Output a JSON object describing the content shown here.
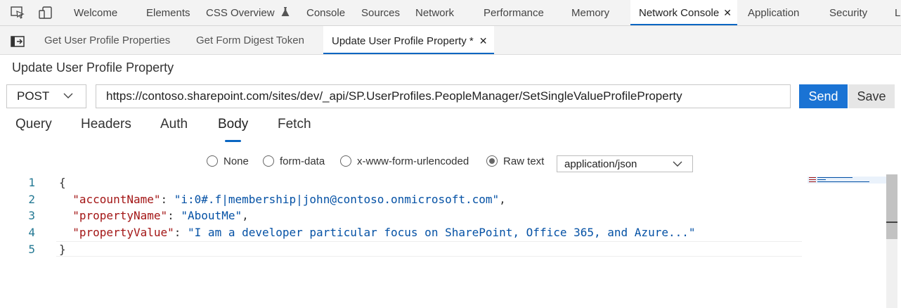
{
  "devtools": {
    "tabs": [
      {
        "label": "Welcome"
      },
      {
        "label": "Elements"
      },
      {
        "label": "CSS Overview"
      },
      {
        "label": "Console"
      },
      {
        "label": "Sources"
      },
      {
        "label": "Network"
      },
      {
        "label": "Performance"
      },
      {
        "label": "Memory"
      },
      {
        "label": "Network Console",
        "active": true
      },
      {
        "label": "Application"
      },
      {
        "label": "Security"
      },
      {
        "label": "L"
      }
    ],
    "close_glyph": "✕"
  },
  "requests": {
    "tabs": [
      {
        "label": "Get User Profile Properties"
      },
      {
        "label": "Get Form Digest Token"
      },
      {
        "label": "Update User Profile Property *",
        "active": true
      }
    ]
  },
  "request": {
    "title": "Update User Profile Property",
    "method": "POST",
    "url": "https://contoso.sharepoint.com/sites/dev/_api/SP.UserProfiles.PeopleManager/SetSingleValueProfileProperty",
    "send_label": "Send",
    "save_label": "Save",
    "tabs": [
      {
        "label": "Query"
      },
      {
        "label": "Headers"
      },
      {
        "label": "Auth"
      },
      {
        "label": "Body",
        "active": true
      },
      {
        "label": "Fetch"
      }
    ]
  },
  "body": {
    "options": [
      {
        "label": "None",
        "selected": false
      },
      {
        "label": "form-data",
        "selected": false
      },
      {
        "label": "x-www-form-urlencoded",
        "selected": false
      },
      {
        "label": "Raw text",
        "selected": true
      }
    ],
    "content_type": "application/json",
    "lines": [
      {
        "num": "1",
        "text": "{"
      },
      {
        "num": "2",
        "key": "\"accountName\"",
        "value": "\"i:0#.f|membership|john@contoso.onmicrosoft.com\"",
        "trail": ","
      },
      {
        "num": "3",
        "key": "\"propertyName\"",
        "value": "\"AboutMe\"",
        "trail": ","
      },
      {
        "num": "4",
        "key": "\"propertyValue\"",
        "value": "\"I am a developer particular focus on SharePoint, Office 365, and Azure...\"",
        "trail": ""
      },
      {
        "num": "5",
        "text": "}"
      }
    ]
  },
  "colors": {
    "accent": "#0a66c2",
    "send_bg": "#1a73d4",
    "json_key": "#a31515",
    "json_string": "#0451a5",
    "line_number": "#237893"
  }
}
